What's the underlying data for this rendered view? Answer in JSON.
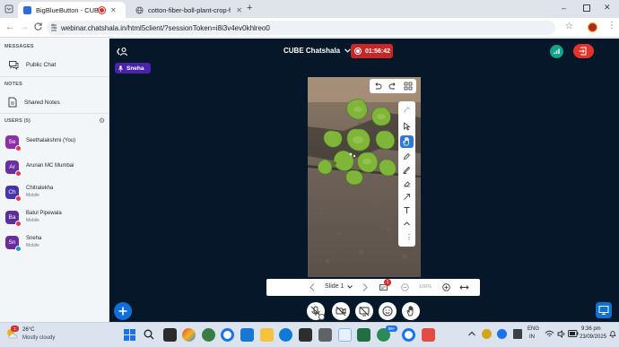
{
  "browser": {
    "tabs": [
      {
        "title": "BigBlueButton - CUBE Chat",
        "active": true
      },
      {
        "title": "cotton-fiber-boll-plant-crop-fie",
        "active": false
      }
    ],
    "url": "webinar.chatshala.in/html5client/?sessionToken=i8i3v4ev0khlreo0"
  },
  "sidebar": {
    "messages_title": "MESSAGES",
    "public_chat": "Public Chat",
    "notes_title": "NOTES",
    "shared_notes": "Shared Notes",
    "users_title": "USERS (5)",
    "users": [
      {
        "initials": "Se",
        "name": "Seethalakshmi (You)",
        "sub": "",
        "color": "#8d2fa7",
        "badge": "#e5334a"
      },
      {
        "initials": "Ar",
        "name": "Arunan MC Mumbai",
        "sub": "",
        "color": "#6a2fa0",
        "badge": "#e5334a"
      },
      {
        "initials": "Ch",
        "name": "Chitralekha",
        "sub": "Mobile",
        "color": "#4a35a8",
        "badge": "#e5334a"
      },
      {
        "initials": "Ba",
        "name": "Batul Pipewala",
        "sub": "Mobile",
        "color": "#5b2e99",
        "badge": "#e5334a"
      },
      {
        "initials": "Sn",
        "name": "Sneha",
        "sub": "Mobile",
        "color": "#6c2b9c",
        "badge": "#1f8fd8"
      }
    ]
  },
  "meeting": {
    "title": "CUBE Chatshala",
    "recording_time": "01:56:42",
    "talker": "Sneha"
  },
  "presentation": {
    "slide_label": "Slide 1",
    "zoom": "100%",
    "notification_count": "1"
  },
  "taskbar": {
    "weather_temp": "26°C",
    "weather_desc": "Mostly cloudy",
    "lang1": "ENG",
    "lang2": "IN",
    "time": "9:36 pm",
    "date": "23/09/2025",
    "notif_count": "1",
    "app_badge": "99+"
  },
  "colors": {
    "accent": "#0f70d7",
    "recording": "#c62828",
    "main_bg": "#06172a",
    "leave": "#e0342d"
  }
}
